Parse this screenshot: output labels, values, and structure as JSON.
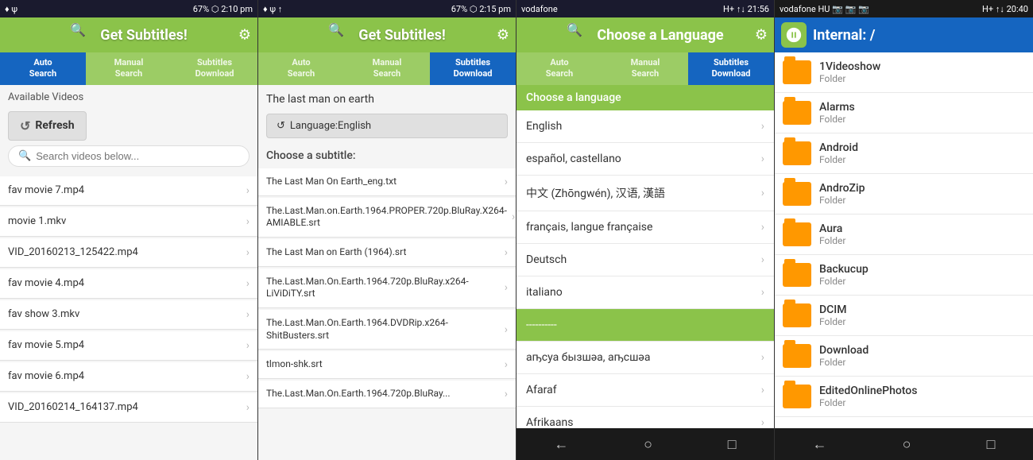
{
  "panel1": {
    "statusBar": {
      "left": "♦ ψ",
      "right": "67% ⬡ 2:10 pm"
    },
    "header": {
      "title": "Get Subtitles!",
      "logo": "🔍"
    },
    "tabs": [
      {
        "label": "Auto\nSearch",
        "active": true
      },
      {
        "label": "Manual\nSearch",
        "active": false
      },
      {
        "label": "Subtitles\nDownload",
        "active": false
      }
    ],
    "sectionLabel": "Available Videos",
    "refreshBtn": "Refresh",
    "searchPlaceholder": "Search videos below...",
    "videos": [
      "fav movie 7.mp4",
      "movie 1.mkv",
      "VID_20160213_125422.mp4",
      "fav movie 4.mp4",
      "fav show 3.mkv",
      "fav movie 5.mp4",
      "fav movie 6.mp4",
      "VID_20160214_164137.mp4"
    ]
  },
  "panel2": {
    "statusBar": {
      "left": "♦ ψ ↑",
      "right": "67% ⬡ 2:15 pm"
    },
    "header": {
      "title": "Get Subtitles!"
    },
    "tabs": [
      {
        "label": "Auto\nSearch",
        "active": false
      },
      {
        "label": "Manual\nSearch",
        "active": false
      },
      {
        "label": "Subtitles\nDownload",
        "active": true
      }
    ],
    "movieTitle": "The last man on earth",
    "languageBtn": "Language:English",
    "subtitleLabel": "Choose a subtitle:",
    "subtitles": [
      "The Last Man On Earth_eng.txt",
      "The.Last.Man.on.Earth.1964.PROPER.720p.BluRay.X264-AMIABLE.srt",
      "The Last Man on Earth (1964).srt",
      "The.Last.Man.On.Earth.1964.720p.BluRay.x264-LiViDiTY.srt",
      "The.Last.Man.On.Earth.1964.DVDRip.x264-ShitBusters.srt",
      "tlmon-shk.srt",
      "The.Last.Man.On.Earth.1964.720p.BluRay..."
    ]
  },
  "panel3": {
    "statusBar": {
      "left": "vodafone",
      "right": "H+ ↑↓ 21:56"
    },
    "header": {
      "title": "Choose a Language"
    },
    "tabs": [
      {
        "label": "Auto\nSearch",
        "active": false
      },
      {
        "label": "Manual\nSearch",
        "active": false
      },
      {
        "label": "Subtitles\nDownload",
        "active": true
      }
    ],
    "sectionHeader": "Choose a language",
    "languages": [
      {
        "name": "English",
        "separator": false
      },
      {
        "name": "español, castellano",
        "separator": false
      },
      {
        "name": "中文 (Zhōngwén), 汉语, 漢語",
        "separator": false
      },
      {
        "name": "français, langue française",
        "separator": false
      },
      {
        "name": "Deutsch",
        "separator": false
      },
      {
        "name": "italiano",
        "separator": false
      },
      {
        "name": "----------",
        "separator": true
      },
      {
        "name": "аҧсуа бызшәа, аҧсшәа",
        "separator": false
      },
      {
        "name": "Afaraf",
        "separator": false
      },
      {
        "name": "Afrikaans",
        "separator": false
      }
    ]
  },
  "panel4": {
    "statusBar": {
      "left": "vodafone HU 📷 📷 📷",
      "right": "H+ ↑↓ 20:40"
    },
    "header": {
      "title": "Internal: /"
    },
    "folders": [
      "1Videoshow",
      "Alarms",
      "Android",
      "AndroZip",
      "Aura",
      "Backucup",
      "DCIM",
      "Download",
      "EditedOnlinePhotos"
    ]
  },
  "nav": {
    "back": "←",
    "home": "○",
    "recent": "□"
  }
}
